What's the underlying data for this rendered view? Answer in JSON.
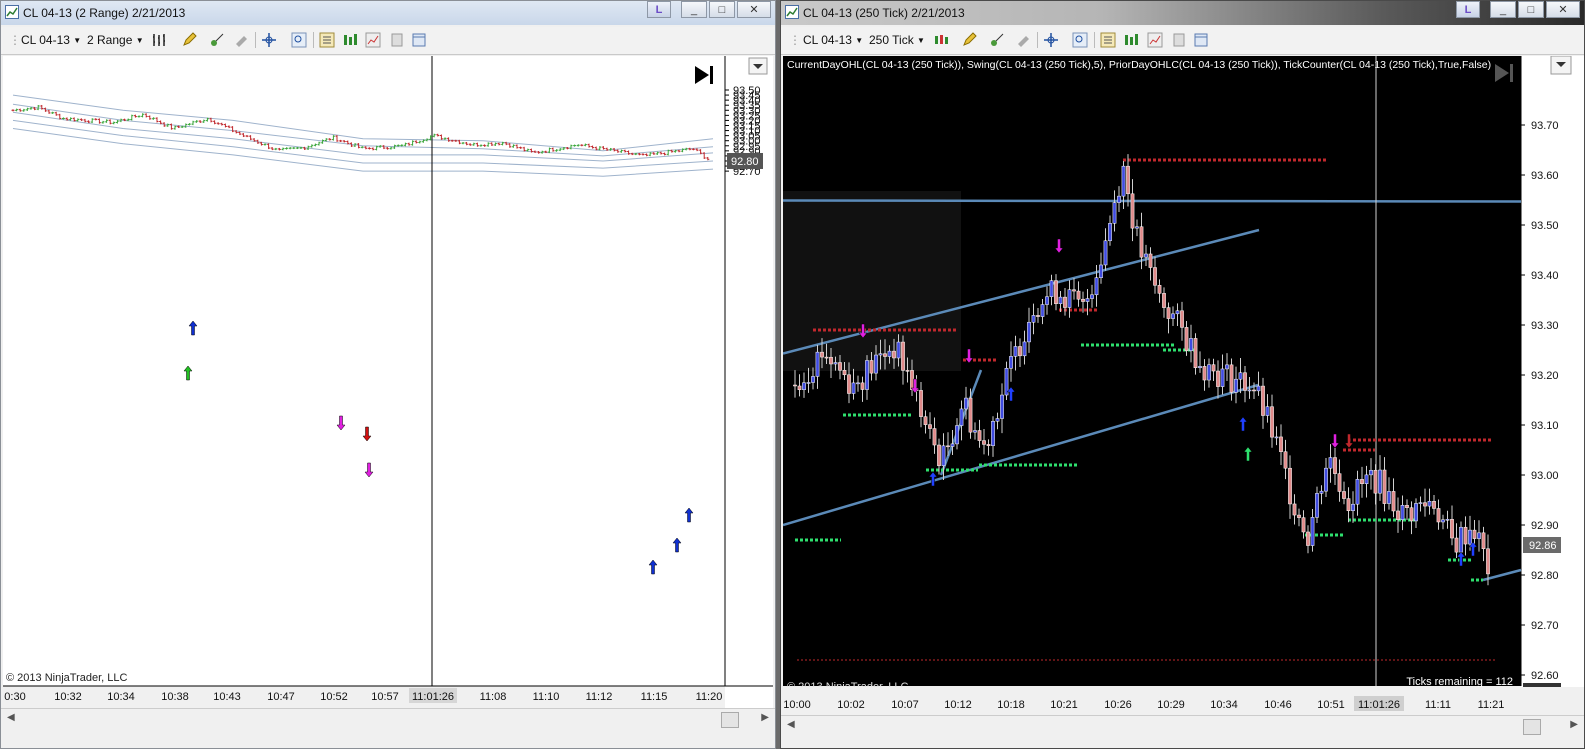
{
  "left_window": {
    "title": "CL 04-13 (2 Range)  2/21/2013",
    "toolbar": {
      "instrument": "CL 04-13",
      "period": "2 Range"
    },
    "window_buttons": [
      "L",
      "_",
      "□",
      "✕"
    ],
    "price_ticks": [
      "93.50",
      "93.45",
      "93.40",
      "93.35",
      "93.30",
      "93.25",
      "93.20",
      "93.15",
      "93.10",
      "93.05",
      "93.00",
      "92.95",
      "92.90",
      "92.85",
      "92.80",
      "92.75",
      "92.70"
    ],
    "last_price": "92.80",
    "time_labels": [
      "0:30",
      "10:32",
      "10:34",
      "10:38",
      "10:43",
      "10:47",
      "10:52",
      "10:57",
      "11:01:26",
      "11:08",
      "11:10",
      "11:12",
      "11:15",
      "11:17",
      "11:20"
    ],
    "copyright": "© 2013 NinjaTrader, LLC",
    "colors": {
      "background": "#ffffff",
      "up_bar": "#3aa63a",
      "down_bar": "#c0282d",
      "bands": "#9fb3cc",
      "arrow_up": "#1030d0",
      "arrow_down": "#d01010",
      "swing_marker": "#e020e0"
    }
  },
  "right_window": {
    "title": "CL 04-13 (250 Tick)  2/21/2013",
    "toolbar": {
      "instrument": "CL 04-13",
      "period": "250 Tick"
    },
    "window_buttons": [
      "L",
      "_",
      "□",
      "✕"
    ],
    "indicator_label": "CurrentDayOHL(CL 04-13 (250 Tick)), Swing(CL 04-13 (250 Tick),5), PriorDayOHLC(CL 04-13 (250 Tick)), TickCounter(CL 04-13 (250 Tick),True,False)",
    "price_ticks": [
      "93.70",
      "93.60",
      "93.50",
      "93.40",
      "93.30",
      "93.20",
      "93.10",
      "93.00",
      "92.90",
      "92.80",
      "92.70",
      "92.60"
    ],
    "current_price": "92.86",
    "bottom_price": "92.57",
    "time_labels": [
      "10:00",
      "10:02",
      "10:07",
      "10:12",
      "10:18",
      "10:21",
      "10:26",
      "10:29",
      "10:34",
      "10:46",
      "10:51",
      "11:01:26",
      "11:11",
      "11:21"
    ],
    "ticks_remaining": "Ticks remaining = 112",
    "copyright": "© 2013 NinjaTrader, LLC",
    "colors": {
      "background": "#000000",
      "up_candle": "#3f4be0",
      "down_candle": "#e08a8a",
      "trendline": "#5b8ab8",
      "swing_high": "#c0282d",
      "swing_low": "#2ee06e"
    }
  }
}
